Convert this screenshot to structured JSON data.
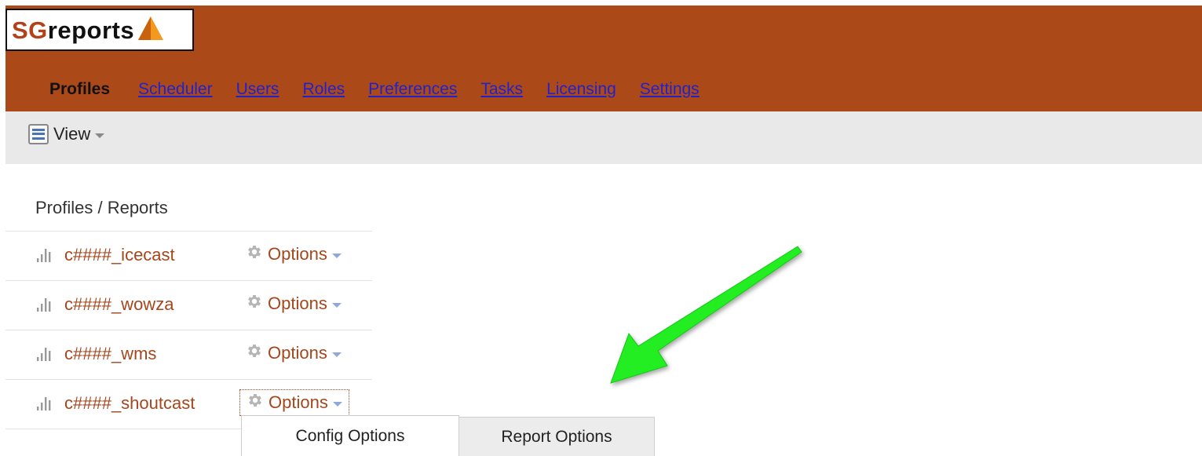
{
  "logo": {
    "sg": "SG",
    "rest": "reports"
  },
  "nav": {
    "profiles": "Profiles",
    "scheduler": "Scheduler",
    "users": "Users",
    "roles": "Roles",
    "preferences": "Preferences",
    "tasks": "Tasks",
    "licensing": "Licensing",
    "settings": "Settings"
  },
  "toolbar": {
    "view_label": "View"
  },
  "main": {
    "title": "Profiles / Reports",
    "profiles": [
      {
        "name": "c####_icecast",
        "options": "Options"
      },
      {
        "name": "c####_wowza",
        "options": "Options"
      },
      {
        "name": "c####_wms",
        "options": "Options"
      },
      {
        "name": "c####_shoutcast",
        "options": "Options"
      }
    ]
  },
  "dropdown": {
    "config": "Config Options",
    "report": "Report Options"
  },
  "colors": {
    "header": "#ab4919",
    "link": "#2222cc",
    "profile_link": "#a5461c",
    "arrow": "#22ee22"
  },
  "icons": [
    "logo-triangle-icon",
    "list-view-icon",
    "chevron-down-icon",
    "bar-chart-icon",
    "gear-icon",
    "arrow-annotation"
  ]
}
